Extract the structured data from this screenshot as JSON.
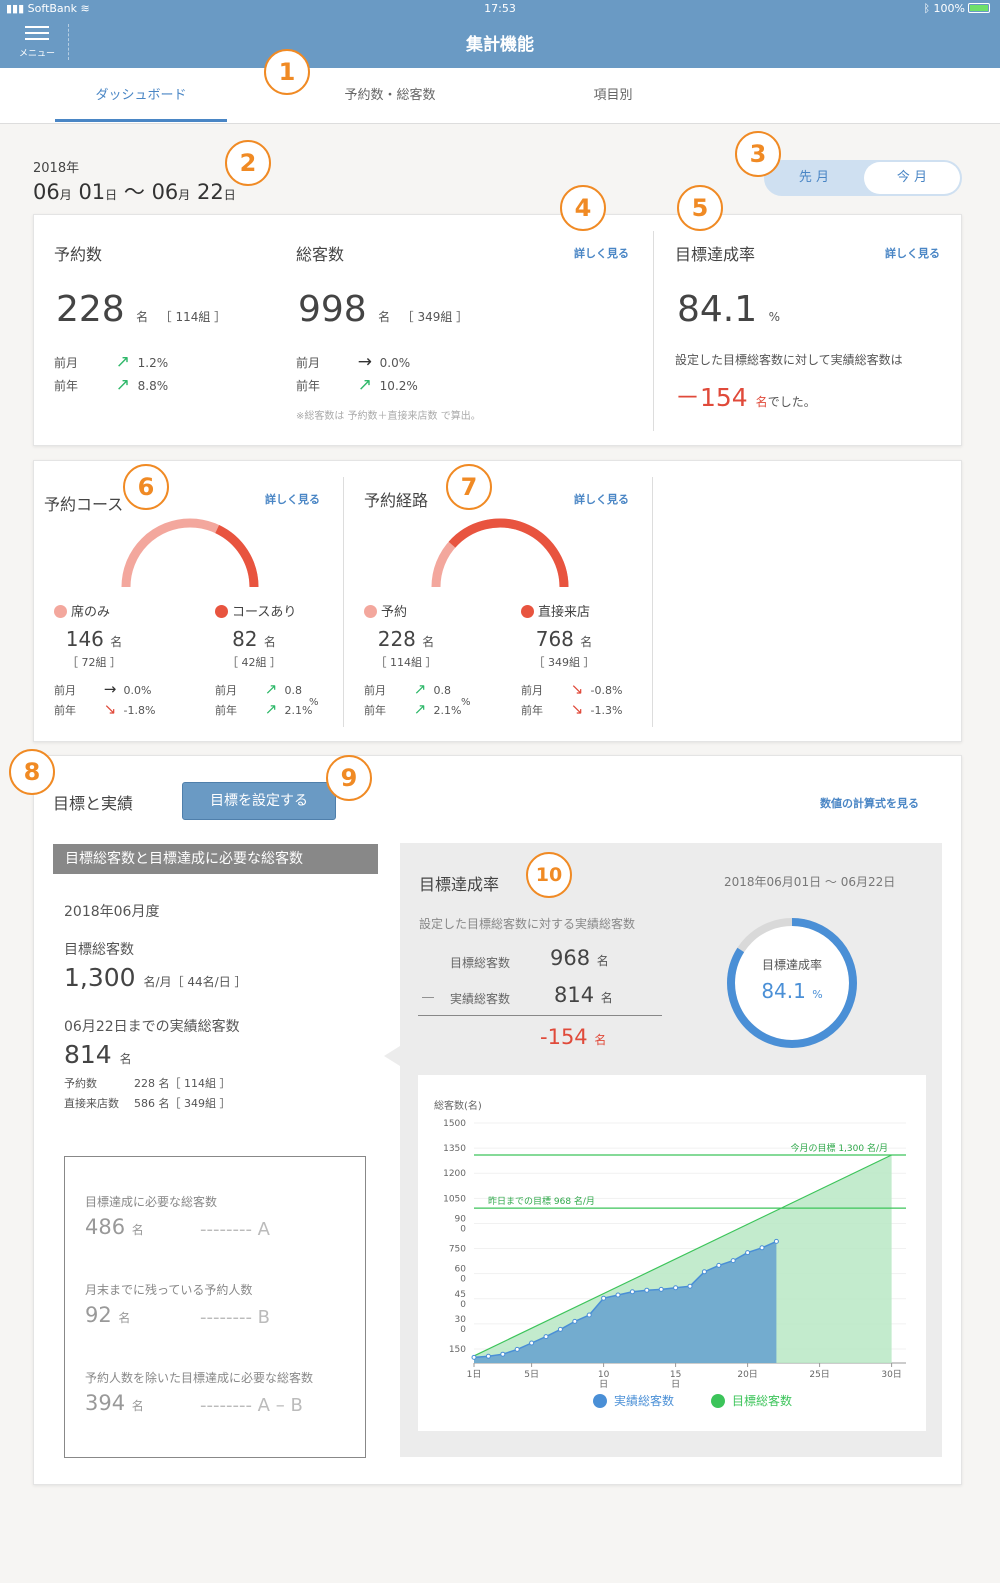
{
  "status": {
    "carrier": "SoftBank",
    "time": "17:53",
    "battery": "100%"
  },
  "header": {
    "menu_label": "メニュー",
    "title": "集計機能"
  },
  "tabs": [
    {
      "label": "ダッシュボード"
    },
    {
      "label": "予約数・総客数"
    },
    {
      "label": "項目別"
    }
  ],
  "callouts": [
    "1",
    "2",
    "3",
    "4",
    "5",
    "6",
    "7",
    "8",
    "9",
    "10"
  ],
  "period": {
    "year": "2018年",
    "start_month": "06",
    "start_day": "01",
    "end_month": "06",
    "end_day": "22",
    "month_unit": "月",
    "day_unit": "日",
    "tilde": "～"
  },
  "segment": {
    "prev": "先 月",
    "current": "今 月"
  },
  "more_label": "詳しく見る",
  "summary": {
    "reservations": {
      "label": "予約数",
      "value": "228",
      "unit": "名",
      "groups": "［ 114組 ］",
      "prev_month": "1.2%",
      "prev_year": "8.8%"
    },
    "visitors": {
      "label": "総客数",
      "value": "998",
      "unit": "名",
      "groups": "［ 349組 ］",
      "prev_month": "0.0%",
      "prev_year": "10.2%",
      "note": "※総客数は 予約数＋直接来店数 で算出。"
    },
    "prev_month_label": "前月",
    "prev_year_label": "前年",
    "achievement": {
      "label": "目標達成率",
      "value": "84.1",
      "unit": "%",
      "desc": "設定した目標総客数に対して実績総客数は",
      "diff": "－154",
      "diff_unit": "名",
      "diff_suffix": "でした。"
    }
  },
  "course": {
    "label": "予約コース",
    "gauge_fraction": 0.36,
    "a": {
      "label": "席のみ",
      "value": "146",
      "unit": "名",
      "groups": "［ 72組 ］",
      "prev_month": "0.0%",
      "prev_year": "-1.8%"
    },
    "b": {
      "label": "コースあり",
      "value": "82",
      "unit": "名",
      "groups": "［ 42組 ］",
      "prev_month": "0.8",
      "prev_year": "2.1%"
    },
    "b_extra": "%"
  },
  "route": {
    "label": "予約経路",
    "gauge_fraction": 0.77,
    "a": {
      "label": "予約",
      "value": "228",
      "unit": "名",
      "groups": "［ 114組 ］",
      "prev_month": "0.8",
      "prev_year": "2.1%"
    },
    "a_extra": "%",
    "b": {
      "label": "直接来店",
      "value": "768",
      "unit": "名",
      "groups": "［ 349組 ］",
      "prev_month": "-0.8%",
      "prev_year": "-1.3%"
    }
  },
  "goal": {
    "title": "目標と実績",
    "set_button": "目標を設定する",
    "formula_link": "数値の計算式を見る",
    "box_head": "目標総客数と目標達成に必要な総客数",
    "fy": "2018年06月度",
    "target_label": "目標総客数",
    "target_value": "1,300",
    "target_unit": "名/月［ 44名/日 ］",
    "actual_label": "06月22日までの実績総客数",
    "actual_value": "814",
    "actual_unit": "名",
    "res_label": "予約数",
    "res_value": "228 名［ 114組 ］",
    "walkin_label": "直接来店数",
    "walkin_value": "586 名［ 349組 ］",
    "needs": [
      {
        "label": "目標達成に必要な総客数",
        "value": "486",
        "unit": "名",
        "tag": "-------- A"
      },
      {
        "label": "月末までに残っている予約人数",
        "value": "92",
        "unit": "名",
        "tag": "-------- B"
      },
      {
        "label": "予約人数を除いた目標達成に必要な総客数",
        "value": "394",
        "unit": "名",
        "tag": "-------- A – B"
      }
    ]
  },
  "rate_panel": {
    "title": "目標達成率",
    "range": "2018年06月01日 ～ 06月22日",
    "desc": "設定した目標総客数に対する実績総客数",
    "target_label": "目標総客数",
    "target_value": "968",
    "actual_label": "実績総客数",
    "actual_value": "814",
    "minus": "―",
    "diff": "-154",
    "unit": "名",
    "ring_label": "目標達成率",
    "ring_value": "84.1",
    "ring_unit": "%",
    "ring_fraction": 0.841
  },
  "chart_data": {
    "type": "area",
    "ylabel": "総客数(名)",
    "yticks": [
      "1500",
      "1350",
      "1200",
      "1050",
      "90\n0",
      "750",
      "60\n0",
      "45\n0",
      "30\n0",
      "150"
    ],
    "xticks": [
      "1日",
      "5日",
      "10\n日",
      "15\n日",
      "20日",
      "25日",
      "30日"
    ],
    "xtick_days": [
      1,
      5,
      10,
      15,
      20,
      25,
      30
    ],
    "ylim": [
      0,
      1500
    ],
    "xlim": [
      1,
      31
    ],
    "series": [
      {
        "name": "実績総客数",
        "color": "#4a8fd6",
        "x": [
          1,
          2,
          3,
          4,
          5,
          6,
          7,
          8,
          9,
          10,
          11,
          12,
          13,
          14,
          15,
          16,
          17,
          18,
          19,
          20,
          21,
          22
        ],
        "values": [
          35,
          42,
          55,
          85,
          125,
          165,
          210,
          260,
          300,
          405,
          425,
          445,
          455,
          460,
          470,
          480,
          570,
          610,
          640,
          690,
          720,
          760
        ]
      },
      {
        "name": "目標総客数",
        "color": "#3cc45a",
        "x": [
          1,
          30
        ],
        "values": [
          44,
          1300
        ]
      }
    ],
    "target_line": {
      "label": "今月の目標",
      "value": "1,300",
      "unit": "名/月",
      "y": 1300
    },
    "yesterday_line": {
      "label": "昨日までの目標",
      "value": "968",
      "unit": "名/月",
      "y": 968
    }
  }
}
